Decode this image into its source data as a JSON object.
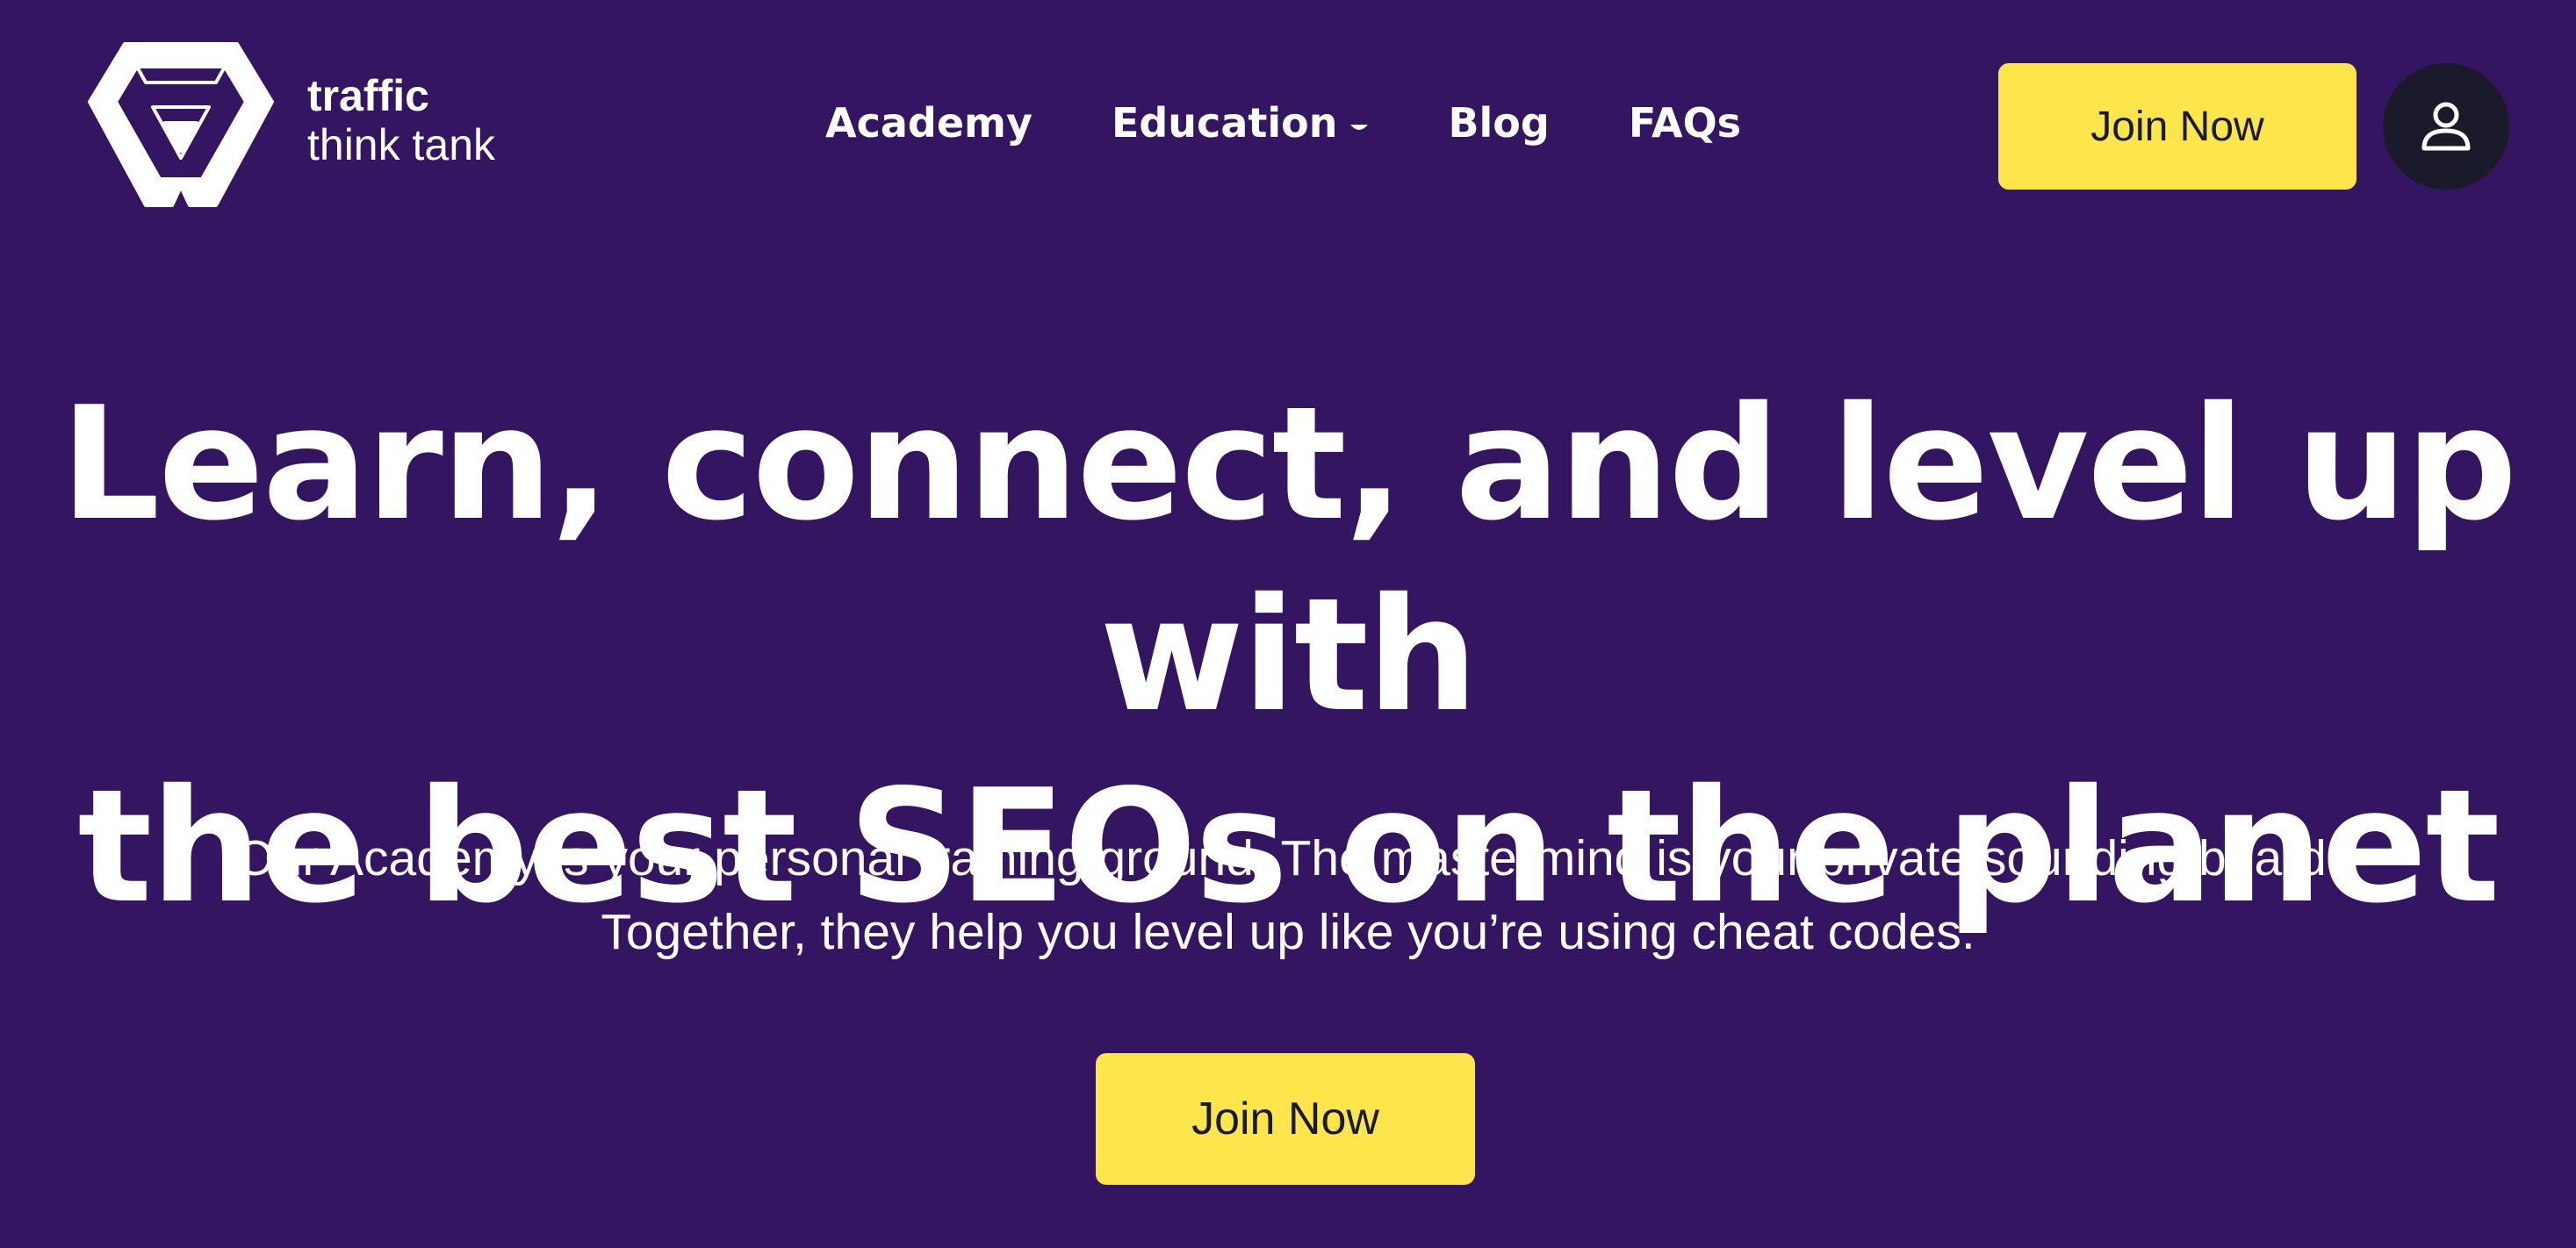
{
  "header": {
    "logo": {
      "line1": "traffic",
      "line2": "think tank"
    },
    "nav": [
      {
        "label": "Academy"
      },
      {
        "label": "Education",
        "has_dropdown": true,
        "icon": "caret-down-icon"
      },
      {
        "label": "Blog"
      },
      {
        "label": "FAQs"
      }
    ],
    "join_label": "Join Now",
    "account_icon": "user-icon"
  },
  "hero": {
    "title_line1": "Learn, connect, and level up with",
    "title_line2": "the best SEOs on the planet",
    "subtitle_line1": "Our Academy is your personal training ground. The mastermind is your private sounding board.",
    "subtitle_line2": "Together, they help you level up like you’re using cheat codes.",
    "cta_label": "Join Now"
  },
  "colors": {
    "background": "#331562",
    "accent": "#fde64b",
    "account_button": "#1b1a2b",
    "text": "#ffffff"
  }
}
